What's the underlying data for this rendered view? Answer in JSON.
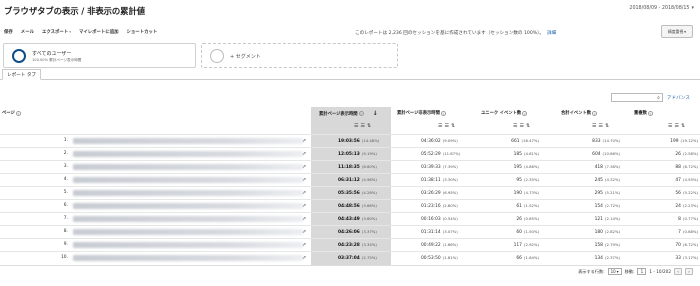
{
  "header": {
    "title": "ブラウザタブの表示 / 非表示の累計値",
    "date_range": "2018/08/09 - 2018/08/15"
  },
  "toolbar": {
    "items": [
      "保存",
      "メール",
      "エクスポート",
      "マイレポートに追加",
      "ショートカット"
    ]
  },
  "report_note": {
    "text": "このレポートは 2,236 回のセッションを基に作成されています（セッション数の 100%）。",
    "link": "詳細"
  },
  "sampling_button": {
    "label": "精度重視"
  },
  "segments": {
    "primary": {
      "label": "すべてのユーザー",
      "sublabel": "100.00% 累計ページ表示時間"
    },
    "add": {
      "label": "+ セグメント"
    }
  },
  "tab": {
    "label": "レポート タブ"
  },
  "search": {
    "advanced_label": "アドバンス"
  },
  "columns": {
    "page": "ページ",
    "m1": "累計ページ表示時間",
    "m2": "累計ページ非表示時間",
    "m3": "ユニーク イベント数",
    "m4": "合計イベント数",
    "m5": "重複数"
  },
  "rows": [
    {
      "idx": "1.",
      "m1": "19:03:56",
      "m1p": "(14.48%)",
      "m2": "04:36:02",
      "m2p": "(9.09%)",
      "m3": "661",
      "m3p": "(16.47%)",
      "m4": "833",
      "m4p": "(14.70%)",
      "m5": "199",
      "m5p": "(19.12%)"
    },
    {
      "idx": "2.",
      "m1": "12:05:13",
      "m1p": "(9.19%)",
      "m2": "05:52:29",
      "m2p": "(11.87%)",
      "m3": "185",
      "m3p": "(4.61%)",
      "m4": "604",
      "m4p": "(10.66%)",
      "m5": "26",
      "m5p": "(2.58%)"
    },
    {
      "idx": "3.",
      "m1": "11:18:35",
      "m1p": "(8.60%)",
      "m2": "03:39:33",
      "m2p": "(7.39%)",
      "m3": "195",
      "m3p": "(4.86%)",
      "m4": "418",
      "m4p": "(7.38%)",
      "m5": "88",
      "m5p": "(8.72%)"
    },
    {
      "idx": "4.",
      "m1": "06:31:12",
      "m1p": "(4.96%)",
      "m2": "01:38:11",
      "m2p": "(3.30%)",
      "m3": "95",
      "m3p": "(2.35%)",
      "m4": "245",
      "m4p": "(4.32%)",
      "m5": "47",
      "m5p": "(4.55%)"
    },
    {
      "idx": "5.",
      "m1": "05:35:56",
      "m1p": "(4.26%)",
      "m2": "03:26:29",
      "m2p": "(6.95%)",
      "m3": "190",
      "m3p": "(4.73%)",
      "m4": "295",
      "m4p": "(5.21%)",
      "m5": "56",
      "m5p": "(5.22%)"
    },
    {
      "idx": "6.",
      "m1": "04:48:56",
      "m1p": "(3.66%)",
      "m2": "01:23:16",
      "m2p": "(2.80%)",
      "m3": "61",
      "m3p": "(1.52%)",
      "m4": "154",
      "m4p": "(2.72%)",
      "m5": "24",
      "m5p": "(2.23%)"
    },
    {
      "idx": "7.",
      "m1": "04:43:49",
      "m1p": "(3.60%)",
      "m2": "00:16:03",
      "m2p": "(0.54%)",
      "m3": "26",
      "m3p": "(0.65%)",
      "m4": "121",
      "m4p": "(2.14%)",
      "m5": "8",
      "m5p": "(0.77%)"
    },
    {
      "idx": "8.",
      "m1": "04:26:06",
      "m1p": "(3.37%)",
      "m2": "01:31:14",
      "m2p": "(3.07%)",
      "m3": "60",
      "m3p": "(1.50%)",
      "m4": "180",
      "m4p": "(2.82%)",
      "m5": "7",
      "m5p": "(0.68%)"
    },
    {
      "idx": "9.",
      "m1": "04:23:28",
      "m1p": "(3.34%)",
      "m2": "00:49:22",
      "m2p": "(1.66%)",
      "m3": "117",
      "m3p": "(2.92%)",
      "m4": "158",
      "m4p": "(2.79%)",
      "m5": "70",
      "m5p": "(6.72%)"
    },
    {
      "idx": "10.",
      "m1": "03:37:04",
      "m1p": "(2.75%)",
      "m2": "00:53:50",
      "m2p": "(1.81%)",
      "m3": "66",
      "m3p": "(1.64%)",
      "m4": "134",
      "m4p": "(2.37%)",
      "m5": "33",
      "m5p": "(3.17%)"
    }
  ],
  "pager": {
    "rows_label": "表示する行数:",
    "rows_value": "10",
    "goto_label": "移動:",
    "goto_value": "1",
    "range": "1 - 10/202"
  }
}
